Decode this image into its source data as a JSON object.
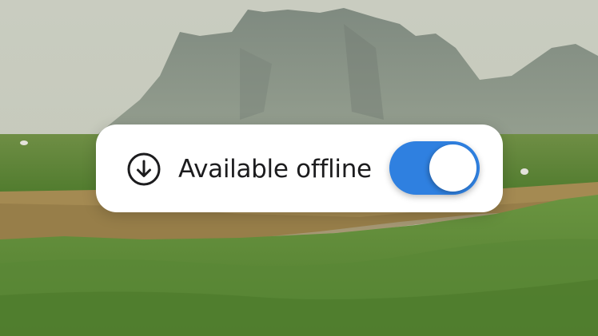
{
  "offline_card": {
    "label": "Available offline",
    "icon": "download-circle-icon",
    "toggle": {
      "state": "on",
      "accent_color": "#2f80e0"
    }
  }
}
